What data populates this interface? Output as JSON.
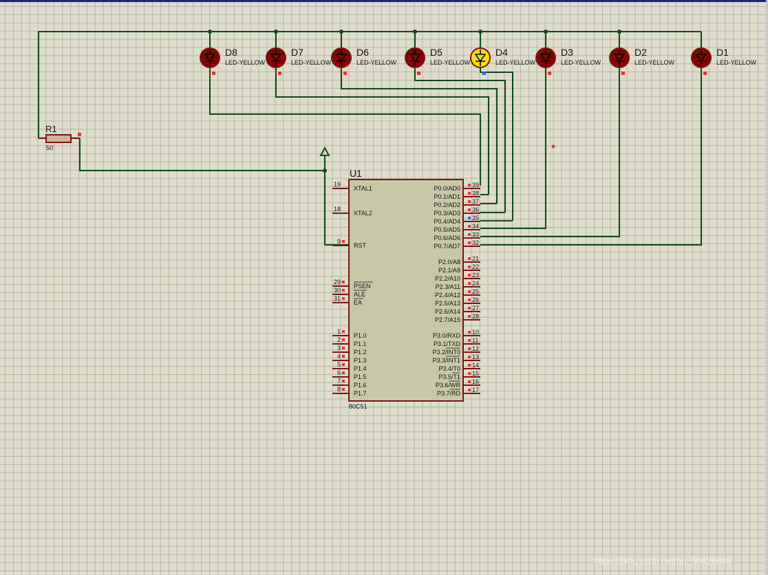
{
  "schematic": {
    "resistor": {
      "ref": "R1",
      "value": "50"
    },
    "mcu": {
      "ref": "U1",
      "part": "80C51",
      "left_pins": [
        {
          "num": "19",
          "name": "XTAL1"
        },
        {
          "num": "18",
          "name": "XTAL2"
        },
        {
          "num": "9",
          "name": "RST"
        },
        {
          "num": "29",
          "name": "PSEN"
        },
        {
          "num": "30",
          "name": "ALE"
        },
        {
          "num": "31",
          "name": "EA"
        },
        {
          "num": "1",
          "name": "P1.0"
        },
        {
          "num": "2",
          "name": "P1.1"
        },
        {
          "num": "3",
          "name": "P1.2"
        },
        {
          "num": "4",
          "name": "P1.3"
        },
        {
          "num": "5",
          "name": "P1.4"
        },
        {
          "num": "6",
          "name": "P1.5"
        },
        {
          "num": "7",
          "name": "P1.6"
        },
        {
          "num": "8",
          "name": "P1.7"
        }
      ],
      "right_pins": [
        {
          "num": "39",
          "name": "P0.0/AD0"
        },
        {
          "num": "38",
          "name": "P0.1/AD1"
        },
        {
          "num": "37",
          "name": "P0.2/AD2"
        },
        {
          "num": "36",
          "name": "P0.3/AD3"
        },
        {
          "num": "35",
          "name": "P0.4/AD4"
        },
        {
          "num": "34",
          "name": "P0.5/AD5"
        },
        {
          "num": "33",
          "name": "P0.6/AD6"
        },
        {
          "num": "32",
          "name": "P0.7/AD7"
        },
        {
          "num": "21",
          "name": "P2.0/A8"
        },
        {
          "num": "22",
          "name": "P2.1/A9"
        },
        {
          "num": "23",
          "name": "P2.2/A10"
        },
        {
          "num": "24",
          "name": "P2.3/A11"
        },
        {
          "num": "25",
          "name": "P2.4/A12"
        },
        {
          "num": "26",
          "name": "P2.5/A13"
        },
        {
          "num": "27",
          "name": "P2.6/A14"
        },
        {
          "num": "28",
          "name": "P2.7/A15"
        },
        {
          "num": "10",
          "name": "P3.0/RXD"
        },
        {
          "num": "11",
          "name": "P3.1/TXD"
        },
        {
          "num": "12",
          "name": "P3.2/INT0"
        },
        {
          "num": "13",
          "name": "P3.3/INT1"
        },
        {
          "num": "14",
          "name": "P3.4/T0"
        },
        {
          "num": "15",
          "name": "P3.5/T1"
        },
        {
          "num": "16",
          "name": "P3.6/WR"
        },
        {
          "num": "17",
          "name": "P3.7/RD"
        }
      ]
    },
    "leds": [
      {
        "ref": "D8",
        "type": "LED-YELLOW",
        "lit": false
      },
      {
        "ref": "D7",
        "type": "LED-YELLOW",
        "lit": false
      },
      {
        "ref": "D6",
        "type": "LED-YELLOW",
        "lit": false
      },
      {
        "ref": "D5",
        "type": "LED-YELLOW",
        "lit": false
      },
      {
        "ref": "D4",
        "type": "LED-YELLOW",
        "lit": true
      },
      {
        "ref": "D3",
        "type": "LED-YELLOW",
        "lit": false
      },
      {
        "ref": "D2",
        "type": "LED-YELLOW",
        "lit": false
      },
      {
        "ref": "D1",
        "type": "LED-YELLOW",
        "lit": false
      }
    ]
  },
  "watermark": "https://blog.csdn.net/qq_50426849",
  "colors": {
    "background": "#deddcc",
    "grid": "#a6a58f",
    "wire": "#0f4a1a",
    "component_outline": "#7a1414",
    "chip_body": "#c9c8a6",
    "led_off": "#8b0000",
    "led_on": "#f4e000",
    "pin_marker": "#e83030",
    "pin_marker_active": "#2f5cff"
  }
}
